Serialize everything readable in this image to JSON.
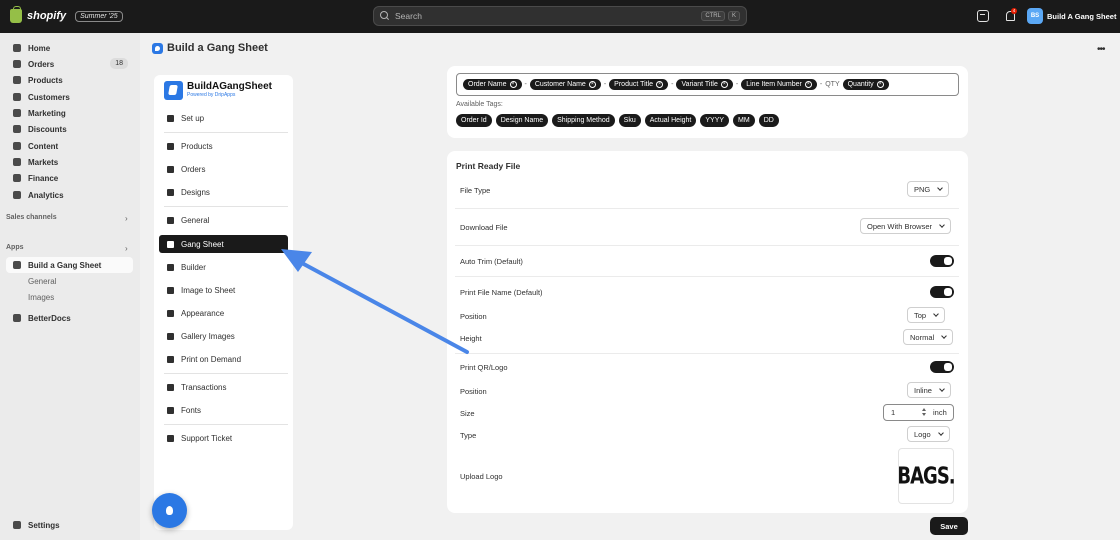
{
  "topbar": {
    "logo_text": "shopify",
    "edition": "Summer '25",
    "search_placeholder": "Search",
    "shortcut_ctrl": "CTRL",
    "shortcut_key": "K",
    "notification_count": "4",
    "avatar_initials": "BS",
    "store_name": "Build A Gang Sheet"
  },
  "sidebar": {
    "items": [
      {
        "label": "Home"
      },
      {
        "label": "Orders",
        "count": "18"
      },
      {
        "label": "Products"
      },
      {
        "label": "Customers"
      },
      {
        "label": "Marketing"
      },
      {
        "label": "Discounts"
      },
      {
        "label": "Content"
      },
      {
        "label": "Markets"
      },
      {
        "label": "Finance"
      },
      {
        "label": "Analytics"
      }
    ],
    "sales_channels": "Sales channels",
    "apps": "Apps",
    "active_app": "Build a Gang Sheet",
    "app_subitems": [
      "General",
      "Images"
    ],
    "other_app": "BetterDocs",
    "settings": "Settings"
  },
  "header": {
    "title": "Build a Gang Sheet"
  },
  "app_nav": {
    "brand_name": "BuildAGangSheet",
    "brand_sub": "Powered by DripApps",
    "items": [
      "Set up",
      "Products",
      "Orders",
      "Designs",
      "General",
      "Gang Sheet",
      "Builder",
      "Image to Sheet",
      "Appearance",
      "Gallery Images",
      "Print on Demand",
      "Transactions",
      "Fonts",
      "Support Ticket"
    ],
    "active": "Gang Sheet"
  },
  "name_format": {
    "tags": [
      "Order Name",
      "Customer Name",
      "Product Title",
      "Variant Title",
      "Line Item Number"
    ],
    "separator": "-",
    "qty_text": "QTY",
    "qty_tag": "Quantity",
    "available_label": "Available Tags:",
    "available_tags": [
      "Order Id",
      "Design Name",
      "Shipping Method",
      "Sku",
      "Actual Height",
      "YYYY",
      "MM",
      "DD"
    ]
  },
  "print_ready": {
    "title": "Print Ready File",
    "file_type_label": "File Type",
    "file_type_value": "PNG",
    "download_label": "Download File",
    "download_value": "Open With Browser",
    "auto_trim_label": "Auto Trim (Default)",
    "auto_trim_on": true,
    "print_name_label": "Print File Name (Default)",
    "print_name_on": true,
    "position_label": "Position",
    "position_value": "Top",
    "height_label": "Height",
    "height_value": "Normal",
    "print_qr_label": "Print QR/Logo",
    "print_qr_on": true,
    "qr_position_label": "Position",
    "qr_position_value": "Inline",
    "size_label": "Size",
    "size_value": "1",
    "size_unit": "inch",
    "type_label": "Type",
    "type_value": "Logo",
    "upload_label": "Upload Logo",
    "logo_text": "BAGS."
  },
  "actions": {
    "save_label": "Save"
  },
  "colors": {
    "accent": "#2b78e4",
    "arrow": "#4a86e8",
    "dark": "#1a1a1a"
  }
}
